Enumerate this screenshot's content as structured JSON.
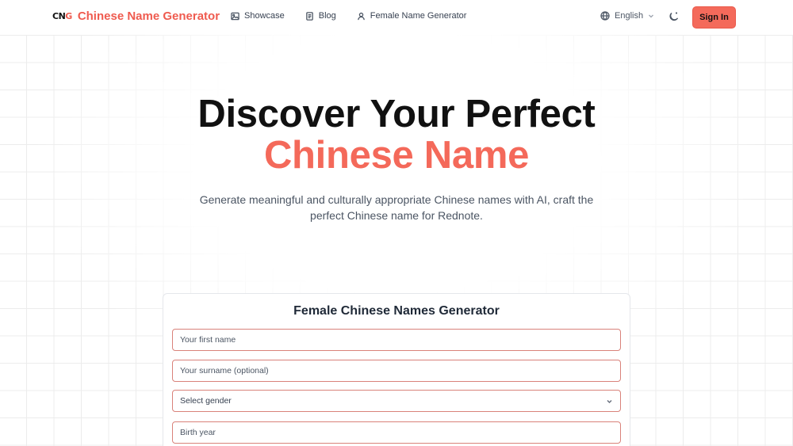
{
  "header": {
    "logo_mark_left": "CN",
    "logo_mark_right": "G",
    "brand_name": "Chinese Name Generator",
    "nav": [
      {
        "label": "Showcase",
        "icon": "image-icon"
      },
      {
        "label": "Blog",
        "icon": "document-icon"
      },
      {
        "label": "Female Name Generator",
        "icon": "user-icon"
      }
    ],
    "language": {
      "label": "English",
      "icon": "globe-icon"
    },
    "theme_icon": "moon-icon",
    "sign_in_label": "Sign In"
  },
  "hero": {
    "title_line1": "Discover Your Perfect",
    "title_line2": "Chinese Name",
    "subtitle": "Generate meaningful and culturally appropriate Chinese names with AI, craft the perfect Chinese name for Rednote."
  },
  "form": {
    "title": "Female Chinese Names Generator",
    "first_name_placeholder": "Your first name",
    "surname_placeholder": "Your surname (optional)",
    "gender_label": "Select gender",
    "birth_year_placeholder": "Birth year"
  },
  "colors": {
    "accent": "#f4695a",
    "field_border": "#d9827a",
    "button_bg": "#f46a5b"
  }
}
